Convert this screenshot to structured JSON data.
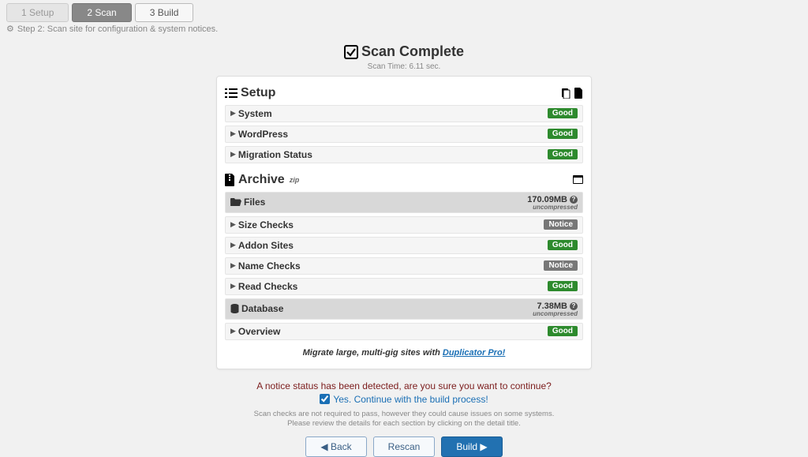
{
  "tabs": {
    "setup": "1 Setup",
    "scan": "2 Scan",
    "build": "3 Build"
  },
  "step_desc": "Step 2: Scan site for configuration & system notices.",
  "scan": {
    "title": "Scan Complete",
    "time": "Scan Time: 6.11 sec."
  },
  "setup_section": {
    "title": "Setup"
  },
  "setup_rows": {
    "system": {
      "label": "System",
      "badge": "Good"
    },
    "wordpress": {
      "label": "WordPress",
      "badge": "Good"
    },
    "migration": {
      "label": "Migration Status",
      "badge": "Good"
    }
  },
  "archive_section": {
    "title": "Archive",
    "sup": "zip"
  },
  "files_header": {
    "label": "Files",
    "size": "170.09MB",
    "uc": "uncompressed"
  },
  "archive_rows": {
    "size_checks": {
      "label": "Size Checks",
      "badge": "Notice"
    },
    "addon_sites": {
      "label": "Addon Sites",
      "badge": "Good"
    },
    "name_checks": {
      "label": "Name Checks",
      "badge": "Notice"
    },
    "read_checks": {
      "label": "Read Checks",
      "badge": "Good"
    }
  },
  "db_header": {
    "label": "Database",
    "size": "7.38MB",
    "uc": "uncompressed"
  },
  "db_rows": {
    "overview": {
      "label": "Overview",
      "badge": "Good"
    }
  },
  "promo": {
    "text": "Migrate large, multi-gig sites with ",
    "link": "Duplicator Pro!"
  },
  "notice": "A notice status has been detected, are you sure you want to continue?",
  "confirm": "Yes. Continue with the build process!",
  "help1": "Scan checks are not required to pass, however they could cause issues on some systems.",
  "help2": "Please review the details for each section by clicking on the detail title.",
  "buttons": {
    "back": "◀ Back",
    "rescan": "Rescan",
    "build": "Build ▶"
  }
}
